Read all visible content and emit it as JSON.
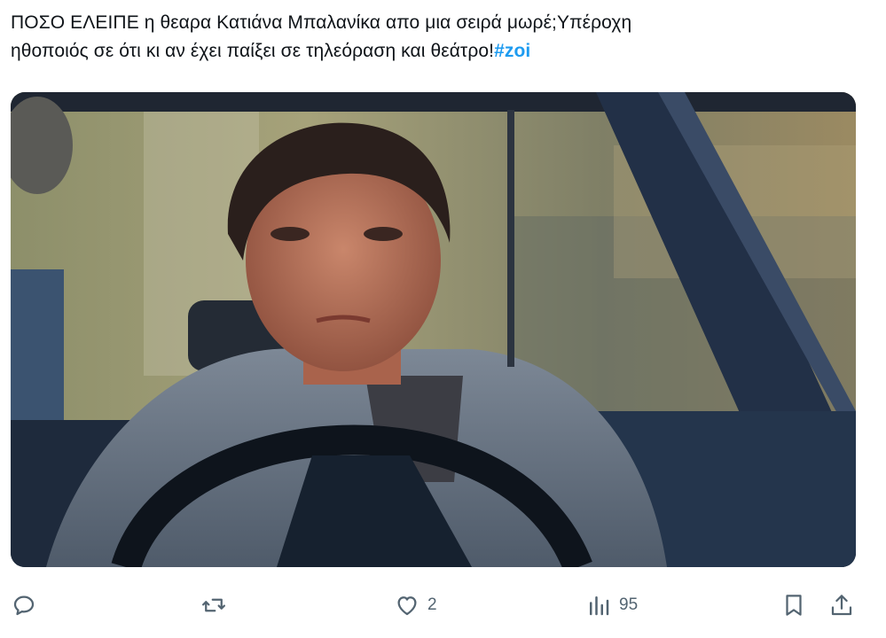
{
  "tweet": {
    "text_line1": "ΠΟΣΟ ΕΛΕΙΠΕ η θεαρα Κατιάνα Μπαλανίκα απο μια σειρά μωρέ;Υπέροχη",
    "text_line2": "ηθοποιός σε ότι κι αν έχει παίξει σε τηλεόραση και θεάτρο!",
    "hashtag": "#zoi"
  },
  "actions": {
    "reply_icon": "reply-icon",
    "retweet_icon": "retweet-icon",
    "like_icon": "heart-icon",
    "like_count": "2",
    "views_icon": "views-bar-chart-icon",
    "views_count": "95",
    "bookmark_icon": "bookmark-icon",
    "share_icon": "share-icon"
  },
  "colors": {
    "hashtag": "#1d9bf0",
    "action_gray": "#536471",
    "text": "#0f1419"
  }
}
